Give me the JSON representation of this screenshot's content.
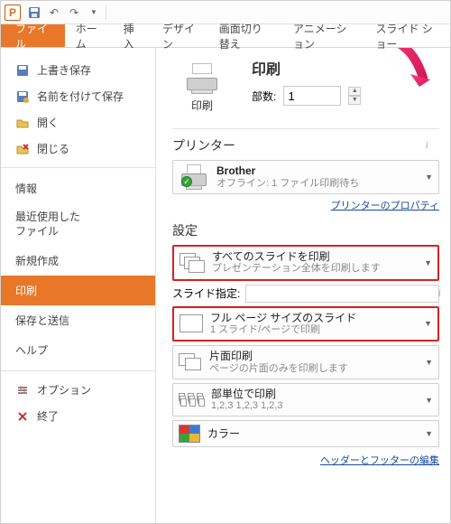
{
  "titlebar": {
    "app_initial": "P"
  },
  "ribbon": {
    "file": "ファイル",
    "tabs": [
      "ホーム",
      "挿入",
      "デザイン",
      "画面切り替え",
      "アニメーション",
      "スライド ショー"
    ]
  },
  "sidebar": {
    "save": "上書き保存",
    "save_as": "名前を付けて保存",
    "open": "開く",
    "close": "閉じる",
    "info": "情報",
    "recent1": "最近使用した",
    "recent2": "ファイル",
    "new": "新規作成",
    "print": "印刷",
    "save_send": "保存と送信",
    "help": "ヘルプ",
    "options": "オプション",
    "exit": "終了"
  },
  "content": {
    "print_header": "印刷",
    "print_btn": "印刷",
    "copies_label": "部数:",
    "copies_value": "1",
    "printer_header": "プリンター",
    "printer_name": "Brother",
    "printer_status": "オフライン: 1 ファイル印刷待ち",
    "printer_props": "プリンターのプロパティ",
    "settings_header": "設定",
    "dd_all_slides_t": "すべてのスライドを印刷",
    "dd_all_slides_s": "プレゼンテーション全体を印刷します",
    "slide_spec_label": "スライド指定:",
    "dd_fullpage_t": "フル ページ サイズのスライド",
    "dd_fullpage_s": "1 スライド/ページで印刷",
    "dd_duplex_t": "片面印刷",
    "dd_duplex_s": "ページの片面のみを印刷します",
    "dd_collate_t": "部単位で印刷",
    "dd_collate_s": "1,2,3   1,2,3   1,2,3",
    "dd_color_t": "カラー",
    "header_footer": "ヘッダーとフッターの編集"
  }
}
